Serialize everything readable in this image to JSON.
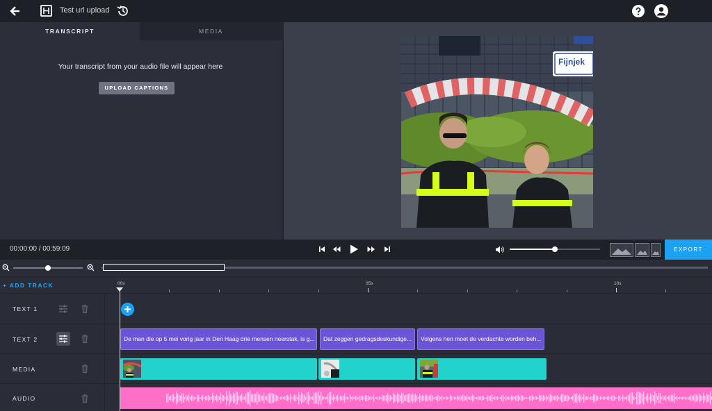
{
  "header": {
    "title": "Test url upload",
    "icons": [
      "back-arrow-icon",
      "logo-icon",
      "history-icon",
      "help-icon",
      "account-icon"
    ]
  },
  "left_panel": {
    "tabs": [
      {
        "label": "TRANSCRIPT",
        "active": true
      },
      {
        "label": "MEDIA",
        "active": false
      }
    ],
    "placeholder_text": "Your transcript from your audio file will appear here",
    "upload_button": "UPLOAD CAPTIONS"
  },
  "transport": {
    "timecode": "00:00:00 / 00:59:09",
    "volume_level": 0.5,
    "export_label": "EXPORT",
    "aspect_options": [
      "landscape",
      "square",
      "portrait"
    ]
  },
  "timeline": {
    "zoom_level": 0.5,
    "add_track_label": "+ ADD TRACK",
    "ruler_labels": [
      "00s",
      "05s",
      "10s"
    ],
    "tracks": [
      {
        "label": "TEXT 1"
      },
      {
        "label": "TEXT 2"
      },
      {
        "label": "MEDIA"
      },
      {
        "label": "AUDIO"
      }
    ],
    "captions": [
      "De man die op 5 mei vorig jaar in Den Haag drie mensen neerstak, is g...",
      "Dat zeggen gedragsdeskundige...",
      "Volgens hen moet de verdachte worden beh..."
    ]
  },
  "colors": {
    "accent": "#1da1f2",
    "caption": "#6b55d6",
    "media": "#22d3cb",
    "audio": "#ff6ec7",
    "waveform": "#e8e8ee"
  }
}
